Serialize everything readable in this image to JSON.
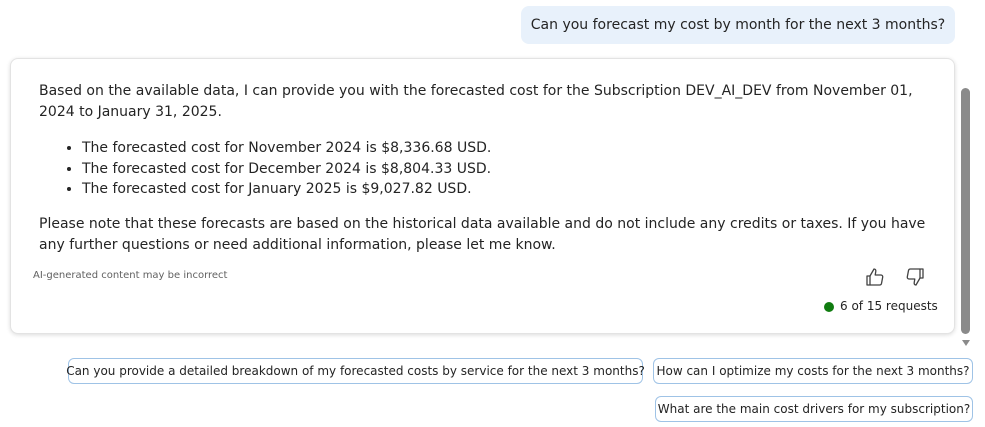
{
  "user_message": "Can you forecast my cost by month for the next 3 months?",
  "response": {
    "intro": "Based on the available data, I can provide you with the forecasted cost for the Subscription DEV_AI_DEV from November 01, 2024 to January 31, 2025.",
    "bullets": [
      "The forecasted cost for November 2024 is $8,336.68 USD.",
      "The forecasted cost for December 2024 is $8,804.33 USD.",
      "The forecasted cost for January 2025 is $9,027.82 USD."
    ],
    "outro": "Please note that these forecasts are based on the historical data available and do not include any credits or taxes. If you have any further questions or need additional information, please let me know.",
    "disclaimer": "AI-generated content may be incorrect",
    "requests_status": "6 of 15 requests",
    "status_color": "#107c10"
  },
  "suggestions": [
    "Can you provide a detailed breakdown of my forecasted costs by service for the next 3 months?",
    "How can I optimize my costs for the next 3 months?",
    "What are the main cost drivers for my subscription?"
  ],
  "icons": [
    "thumbs-up-icon",
    "thumbs-down-icon",
    "scroll-down-arrow-icon"
  ]
}
